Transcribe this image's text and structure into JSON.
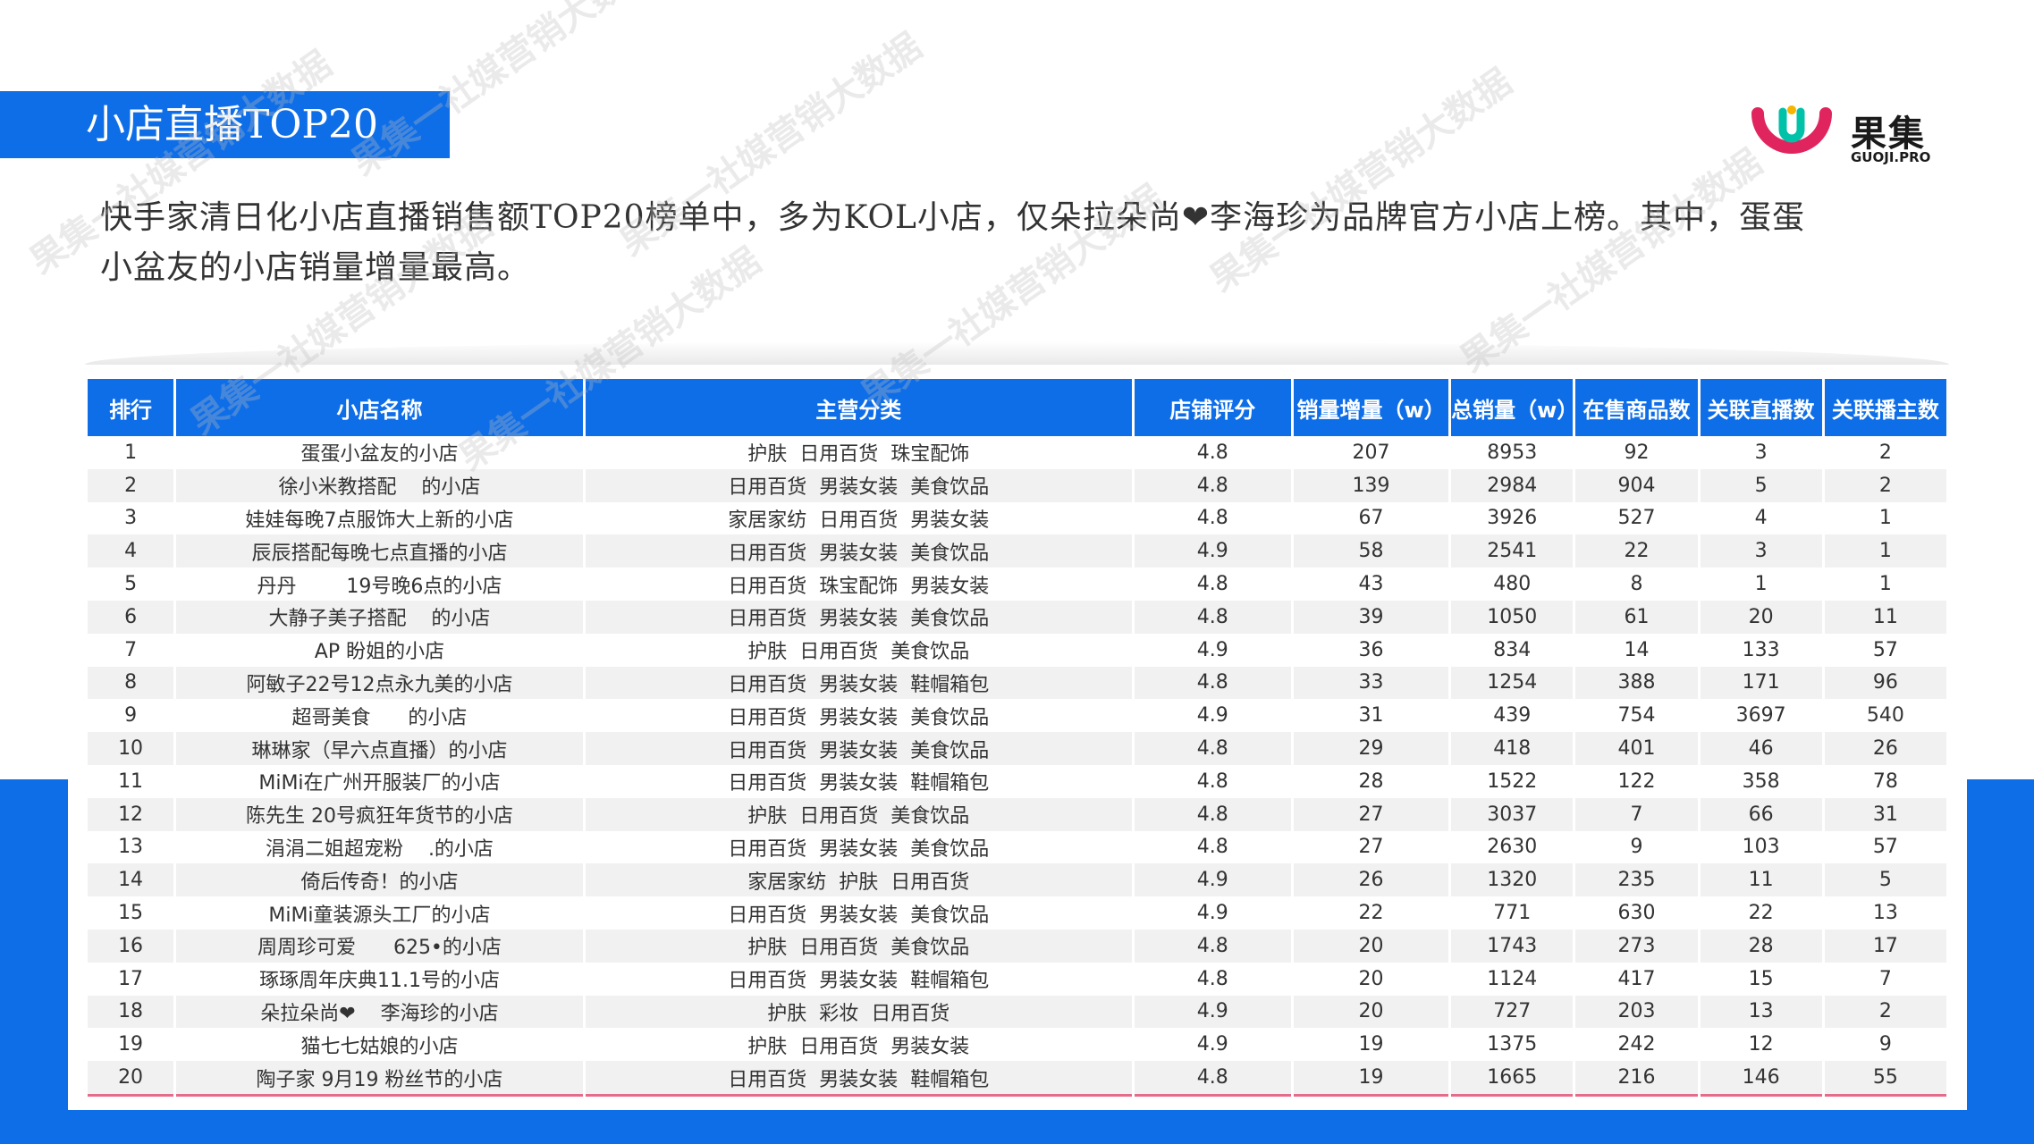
{
  "page": {
    "title": "小店直播TOP20",
    "intro_part1": "快手家清日化小店直播销售额TOP20榜单中，多为KOL小店，仅朵拉朵尚",
    "intro_heart": "❤",
    "intro_part2": "李海珍为品牌官方小店上榜。其中，蛋蛋小盆友的小店销量增量最高。"
  },
  "logo": {
    "name": "果集",
    "sub": "GUOJI.PRO",
    "icon": "guoji-logo-icon",
    "colors": [
      "#00c2a8",
      "#e0245e",
      "#f7b500"
    ]
  },
  "watermark": {
    "text": "果集一社媒营销大数据"
  },
  "colors": {
    "accent": "#0e6ee8",
    "stripe": "#f1f1f1",
    "bottom_line": "#e66a8a"
  },
  "table": {
    "columns": [
      "排行",
      "小店名称",
      "主营分类",
      "店铺评分",
      "销量增量（w）",
      "总销量（w）",
      "在售商品数",
      "关联直播数",
      "关联播主数"
    ],
    "rows": [
      [
        "1",
        "蛋蛋小盆友的小店",
        "护肤  日用百货  珠宝配饰",
        "4.8",
        "207",
        "8953",
        "92",
        "3",
        "2"
      ],
      [
        "2",
        "徐小米教搭配    的小店",
        "日用百货  男装女装  美食饮品",
        "4.8",
        "139",
        "2984",
        "904",
        "5",
        "2"
      ],
      [
        "3",
        "娃娃每晚7点服饰大上新的小店",
        "家居家纺  日用百货  男装女装",
        "4.8",
        "67",
        "3926",
        "527",
        "4",
        "1"
      ],
      [
        "4",
        "辰辰搭配每晚七点直播的小店",
        "日用百货  男装女装  美食饮品",
        "4.9",
        "58",
        "2541",
        "22",
        "3",
        "1"
      ],
      [
        "5",
        "丹丹        19号晚6点的小店",
        "日用百货  珠宝配饰  男装女装",
        "4.8",
        "43",
        "480",
        "8",
        "1",
        "1"
      ],
      [
        "6",
        "大静子美子搭配    的小店",
        "日用百货  男装女装  美食饮品",
        "4.8",
        "39",
        "1050",
        "61",
        "20",
        "11"
      ],
      [
        "7",
        "AP 盼姐的小店",
        "护肤  日用百货  美食饮品",
        "4.9",
        "36",
        "834",
        "14",
        "133",
        "57"
      ],
      [
        "8",
        "阿敏子22号12点永九美的小店",
        "日用百货  男装女装  鞋帽箱包",
        "4.8",
        "33",
        "1254",
        "388",
        "171",
        "96"
      ],
      [
        "9",
        "超哥美食      的小店",
        "日用百货  男装女装  美食饮品",
        "4.9",
        "31",
        "439",
        "754",
        "3697",
        "540"
      ],
      [
        "10",
        "琳琳家（早六点直播）的小店",
        "日用百货  男装女装  美食饮品",
        "4.8",
        "29",
        "418",
        "401",
        "46",
        "26"
      ],
      [
        "11",
        "MiMi在广州开服装厂的小店",
        "日用百货  男装女装  鞋帽箱包",
        "4.8",
        "28",
        "1522",
        "122",
        "358",
        "78"
      ],
      [
        "12",
        "陈先生 20号疯狂年货节的小店",
        "护肤  日用百货  美食饮品",
        "4.8",
        "27",
        "3037",
        "7",
        "66",
        "31"
      ],
      [
        "13",
        "涓涓二姐超宠粉    .的小店",
        "日用百货  男装女装  美食饮品",
        "4.8",
        "27",
        "2630",
        "9",
        "103",
        "57"
      ],
      [
        "14",
        "倚后传奇！的小店",
        "家居家纺  护肤  日用百货",
        "4.9",
        "26",
        "1320",
        "235",
        "11",
        "5"
      ],
      [
        "15",
        "MiMi童装源头工厂的小店",
        "日用百货  男装女装  美食饮品",
        "4.9",
        "22",
        "771",
        "630",
        "22",
        "13"
      ],
      [
        "16",
        "周周珍可爱      625•的小店",
        "护肤  日用百货  美食饮品",
        "4.8",
        "20",
        "1743",
        "273",
        "28",
        "17"
      ],
      [
        "17",
        "琢琢周年庆典11.1号的小店",
        "日用百货  男装女装  鞋帽箱包",
        "4.8",
        "20",
        "1124",
        "417",
        "15",
        "7"
      ],
      [
        "18",
        "朵拉朵尚❤    李海珍的小店",
        "护肤  彩妆  日用百货",
        "4.9",
        "20",
        "727",
        "203",
        "13",
        "2"
      ],
      [
        "19",
        "猫七七姑娘的小店",
        "护肤  日用百货  男装女装",
        "4.9",
        "19",
        "1375",
        "242",
        "12",
        "9"
      ],
      [
        "20",
        "陶子家 9月19 粉丝节的小店",
        "日用百货  男装女装  鞋帽箱包",
        "4.8",
        "19",
        "1665",
        "216",
        "146",
        "55"
      ]
    ]
  }
}
